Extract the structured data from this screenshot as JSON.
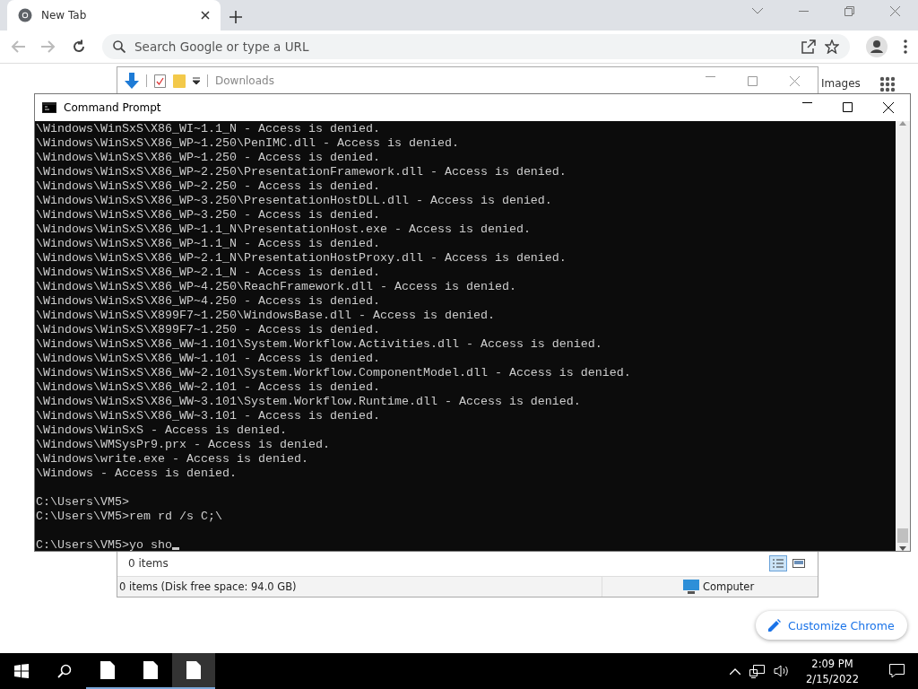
{
  "browser": {
    "tab": {
      "title": "New Tab"
    },
    "omnibox": {
      "placeholder": "Search Google or type a URL"
    },
    "images_link": "Images",
    "customize_button": "Customize Chrome"
  },
  "explorer": {
    "title": "Downloads",
    "item_count": "0 items",
    "status": "0 items (Disk free space: 94.0 GB)",
    "location": "Computer"
  },
  "console": {
    "title": "Command Prompt",
    "blocks": [
      [
        "\\Windows\\WinSxS\\X86_WI~1.1_N - Access is denied.",
        "\\Windows\\WinSxS\\X86_WP~1.250\\PenIMC.dll - Access is denied.",
        "\\Windows\\WinSxS\\X86_WP~1.250 - Access is denied.",
        "\\Windows\\WinSxS\\X86_WP~2.250\\PresentationFramework.dll - Access is denied.",
        "\\Windows\\WinSxS\\X86_WP~2.250 - Access is denied.",
        "\\Windows\\WinSxS\\X86_WP~3.250\\PresentationHostDLL.dll - Access is denied.",
        "\\Windows\\WinSxS\\X86_WP~3.250 - Access is denied.",
        "\\Windows\\WinSxS\\X86_WP~1.1_N\\PresentationHost.exe - Access is denied.",
        "\\Windows\\WinSxS\\X86_WP~1.1_N - Access is denied.",
        "\\Windows\\WinSxS\\X86_WP~2.1_N\\PresentationHostProxy.dll - Access is denied.",
        "\\Windows\\WinSxS\\X86_WP~2.1_N - Access is denied.",
        "\\Windows\\WinSxS\\X86_WP~4.250\\ReachFramework.dll - Access is denied.",
        "\\Windows\\WinSxS\\X86_WP~4.250 - Access is denied.",
        "\\Windows\\WinSxS\\X899F7~1.250\\WindowsBase.dll - Access is denied.",
        "\\Windows\\WinSxS\\X899F7~1.250 - Access is denied.",
        "\\Windows\\WinSxS\\X86_WW~1.101\\System.Workflow.Activities.dll - Access is denied.",
        "\\Windows\\WinSxS\\X86_WW~1.101 - Access is denied.",
        "\\Windows\\WinSxS\\X86_WW~2.101\\System.Workflow.ComponentModel.dll - Access is denied.",
        "\\Windows\\WinSxS\\X86_WW~2.101 - Access is denied.",
        "\\Windows\\WinSxS\\X86_WW~3.101\\System.Workflow.Runtime.dll - Access is denied.",
        "\\Windows\\WinSxS\\X86_WW~3.101 - Access is denied.",
        "\\Windows\\WinSxS - Access is denied.",
        "\\Windows\\WMSysPr9.prx - Access is denied.",
        "\\Windows\\write.exe - Access is denied.",
        "\\Windows - Access is denied."
      ],
      [
        "C:\\Users\\VM5>",
        "C:\\Users\\VM5>rem rd /s C;\\"
      ],
      [
        "C:\\Users\\VM5>yo sho"
      ]
    ]
  },
  "taskbar": {
    "time": "2:09 PM",
    "date": "2/15/2022",
    "apps": [
      {
        "selected": false
      },
      {
        "selected": false
      },
      {
        "selected": true
      }
    ]
  }
}
